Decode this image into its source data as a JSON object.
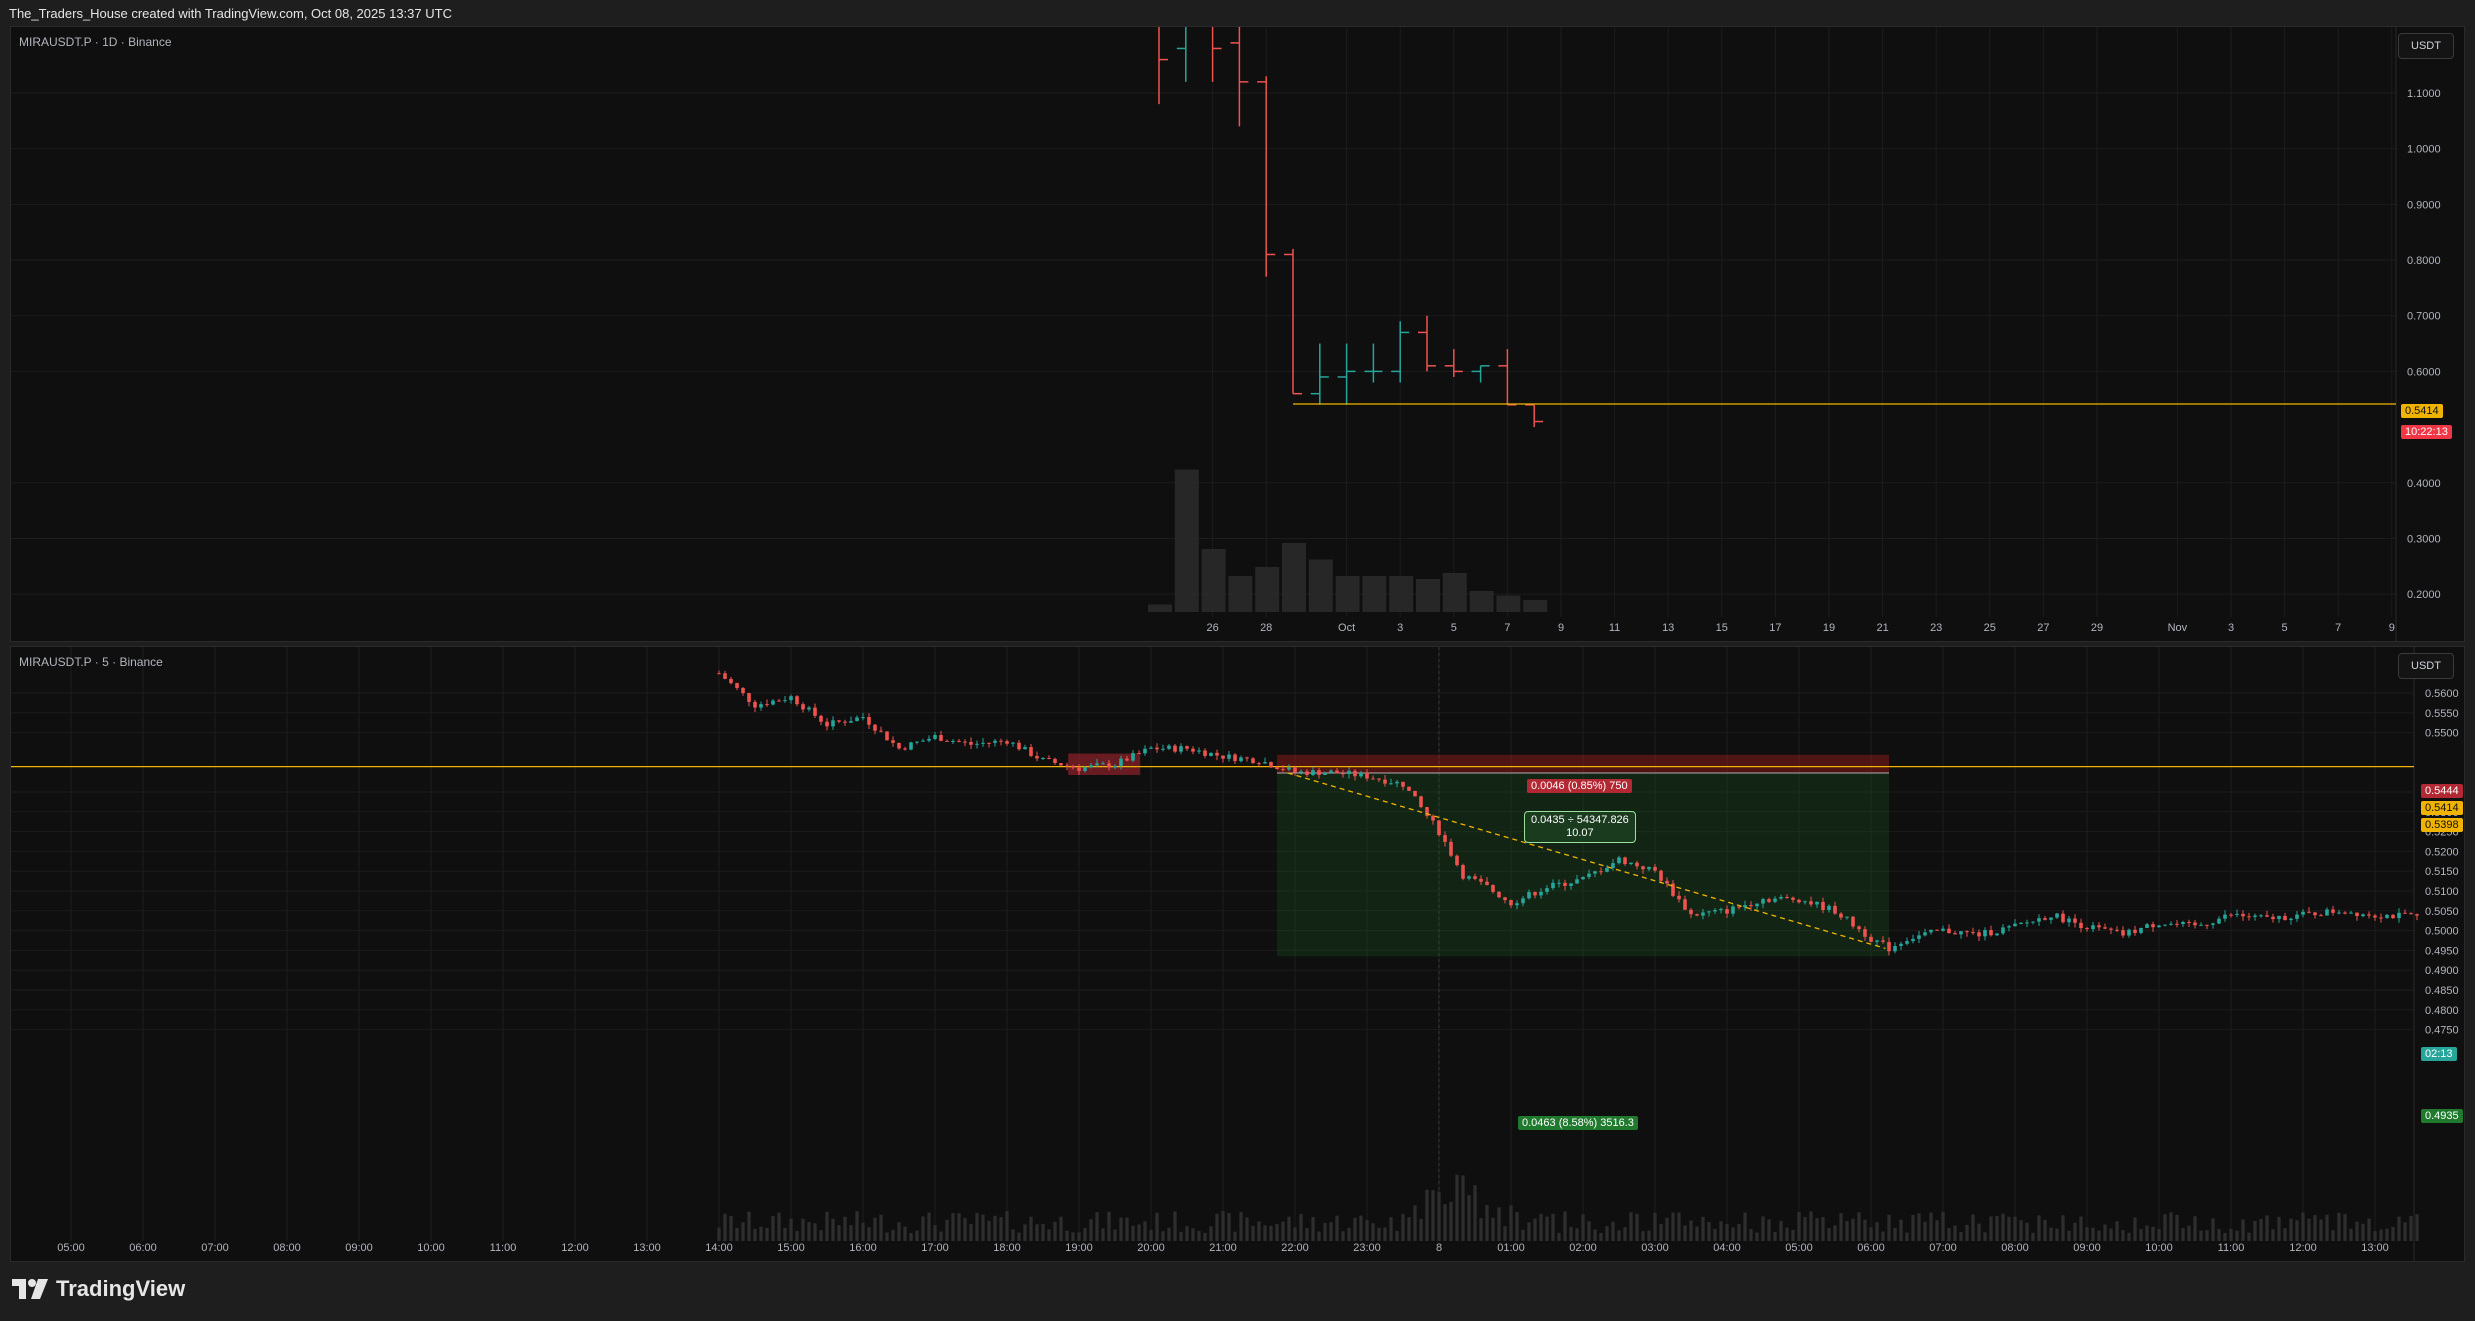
{
  "header": {
    "caption": "The_Traders_House created with TradingView.com, Oct 08, 2025 13:37 UTC"
  },
  "colors": {
    "up": "#26a69a",
    "down": "#ef5350",
    "level": "#f0b400",
    "grid": "#1c1c1c",
    "stop": "#b71c1c",
    "target": "#1b5e20"
  },
  "pane_top": {
    "symbol_label": "MIRAUSDT.P · 1D · Binance",
    "unit": "USDT",
    "price_tag": "0.5414",
    "countdown_tag": "10:22:13"
  },
  "pane_bottom": {
    "symbol_label": "MIRAUSDT.P · 5 · Binance",
    "unit": "USDT",
    "tags": {
      "stop": "0.5444",
      "level": "0.5414",
      "entry": "0.5398",
      "countdown": "02:13",
      "target": "0.4935"
    },
    "position_tool": {
      "risk_label": "0.0046 (0.85%) 750",
      "mid_line1": "0.0435 ÷ 54347.826",
      "mid_line2": "10.07",
      "reward_label": "0.0463 (8.58%) 3516.3"
    }
  },
  "footer": {
    "brand": "TradingView",
    "logo": "tradingview-logo"
  },
  "chart_data": [
    {
      "type": "bar",
      "title": "MIRAUSDT.P · 1D · Binance",
      "timeframe": "1D",
      "x_ticks": [
        "26",
        "28",
        "Oct",
        "3",
        "5",
        "7",
        "9",
        "11",
        "13",
        "15",
        "17",
        "19",
        "21",
        "23",
        "25",
        "27",
        "29",
        "Nov",
        "3",
        "5",
        "7",
        "9"
      ],
      "y_ticks": [
        "1.1000",
        "1.0000",
        "0.9000",
        "0.8000",
        "0.7000",
        "0.6000",
        "0.4000",
        "0.3000",
        "0.2000"
      ],
      "ylim": [
        0.16,
        1.24
      ],
      "last_price": 0.5414,
      "level_line": 0.5414,
      "series": [
        {
          "dates": [
            "Sep 24",
            "Sep 25",
            "Sep 26",
            "Sep 27",
            "Sep 28",
            "Sep 29",
            "Sep 30",
            "Oct 1",
            "Oct 2",
            "Oct 3",
            "Oct 4",
            "Oct 5",
            "Oct 6",
            "Oct 7",
            "Oct 8"
          ],
          "open": [
            1.26,
            1.18,
            1.22,
            1.19,
            1.12,
            0.81,
            0.56,
            0.59,
            0.6,
            0.6,
            0.67,
            0.61,
            0.6,
            0.61,
            0.54
          ],
          "high": [
            1.3,
            1.34,
            1.27,
            1.25,
            1.13,
            0.82,
            0.65,
            0.65,
            0.65,
            0.69,
            0.7,
            0.64,
            0.61,
            0.64,
            0.54
          ],
          "low": [
            1.08,
            1.12,
            1.12,
            1.04,
            0.77,
            0.56,
            0.54,
            0.54,
            0.58,
            0.58,
            0.6,
            0.59,
            0.58,
            0.54,
            0.5
          ],
          "close": [
            1.16,
            1.22,
            1.18,
            1.12,
            0.81,
            0.56,
            0.59,
            0.6,
            0.6,
            0.67,
            0.61,
            0.6,
            0.61,
            0.54,
            0.51
          ],
          "volume": [
            0.05,
            0.95,
            0.42,
            0.24,
            0.3,
            0.46,
            0.35,
            0.24,
            0.24,
            0.24,
            0.22,
            0.26,
            0.14,
            0.11,
            0.08
          ]
        }
      ]
    },
    {
      "type": "bar",
      "title": "MIRAUSDT.P · 5 · Binance",
      "timeframe": "5m",
      "x_ticks": [
        "05:00",
        "06:00",
        "07:00",
        "08:00",
        "09:00",
        "10:00",
        "11:00",
        "12:00",
        "13:00",
        "14:00",
        "15:00",
        "16:00",
        "17:00",
        "18:00",
        "19:00",
        "20:00",
        "21:00",
        "22:00",
        "23:00",
        "8",
        "01:00",
        "02:00",
        "03:00",
        "04:00",
        "05:00",
        "06:00",
        "07:00",
        "08:00",
        "09:00",
        "10:00",
        "11:00",
        "12:00",
        "13:00"
      ],
      "y_ticks": [
        "0.5600",
        "0.5550",
        "0.5500",
        "0.5350",
        "0.5300",
        "0.5250",
        "0.5200",
        "0.5150",
        "0.5100",
        "0.5050",
        "0.5000",
        "0.4950",
        "0.4900",
        "0.4850",
        "0.4800",
        "0.4750"
      ],
      "ylim": [
        0.4745,
        0.564
      ],
      "level_line": 0.5414,
      "position": {
        "entry": 0.5398,
        "stop": 0.5444,
        "target": 0.4935,
        "start": "21:45",
        "end": "06:15"
      },
      "anchor_points": [
        [
          "14:00",
          0.565
        ],
        [
          "14:30",
          0.557
        ],
        [
          "15:00",
          0.559
        ],
        [
          "15:30",
          0.552
        ],
        [
          "16:00",
          0.554
        ],
        [
          "16:30",
          0.546
        ],
        [
          "17:00",
          0.549
        ],
        [
          "17:30",
          0.547
        ],
        [
          "18:00",
          0.548
        ],
        [
          "18:30",
          0.543
        ],
        [
          "19:00",
          0.541
        ],
        [
          "19:30",
          0.542
        ],
        [
          "20:00",
          0.546
        ],
        [
          "20:30",
          0.546
        ],
        [
          "21:00",
          0.544
        ],
        [
          "21:30",
          0.543
        ],
        [
          "22:00",
          0.54
        ],
        [
          "22:30",
          0.54
        ],
        [
          "23:00",
          0.539
        ],
        [
          "23:30",
          0.537
        ],
        [
          "23:45",
          0.531
        ],
        [
          "00:00",
          0.525
        ],
        [
          "00:20",
          0.514
        ],
        [
          "00:40",
          0.511
        ],
        [
          "01:00",
          0.507
        ],
        [
          "01:30",
          0.511
        ],
        [
          "02:00",
          0.513
        ],
        [
          "02:30",
          0.518
        ],
        [
          "03:00",
          0.515
        ],
        [
          "03:30",
          0.504
        ],
        [
          "04:00",
          0.505
        ],
        [
          "04:30",
          0.508
        ],
        [
          "05:00",
          0.508
        ],
        [
          "05:30",
          0.505
        ],
        [
          "06:00",
          0.498
        ],
        [
          "06:15",
          0.4955
        ],
        [
          "06:30",
          0.498
        ],
        [
          "07:00",
          0.5
        ],
        [
          "07:30",
          0.499
        ],
        [
          "08:00",
          0.501
        ],
        [
          "08:30",
          0.504
        ],
        [
          "09:00",
          0.501
        ],
        [
          "09:30",
          0.499
        ],
        [
          "10:00",
          0.502
        ],
        [
          "10:30",
          0.501
        ],
        [
          "11:00",
          0.504
        ],
        [
          "11:30",
          0.503
        ],
        [
          "12:00",
          0.504
        ],
        [
          "12:30",
          0.505
        ],
        [
          "13:00",
          0.504
        ],
        [
          "13:35",
          0.5035
        ]
      ]
    }
  ]
}
